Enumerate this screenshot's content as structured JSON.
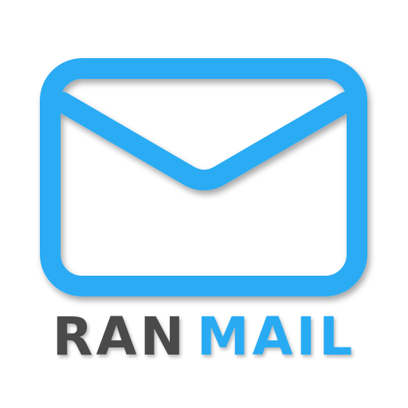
{
  "logo": {
    "word_primary": "RAN",
    "word_accent": "MAIL",
    "colors": {
      "primary_text": "#4a4a4a",
      "accent": "#29abf4",
      "background": "#ffffff"
    },
    "icon": "envelope-icon"
  }
}
